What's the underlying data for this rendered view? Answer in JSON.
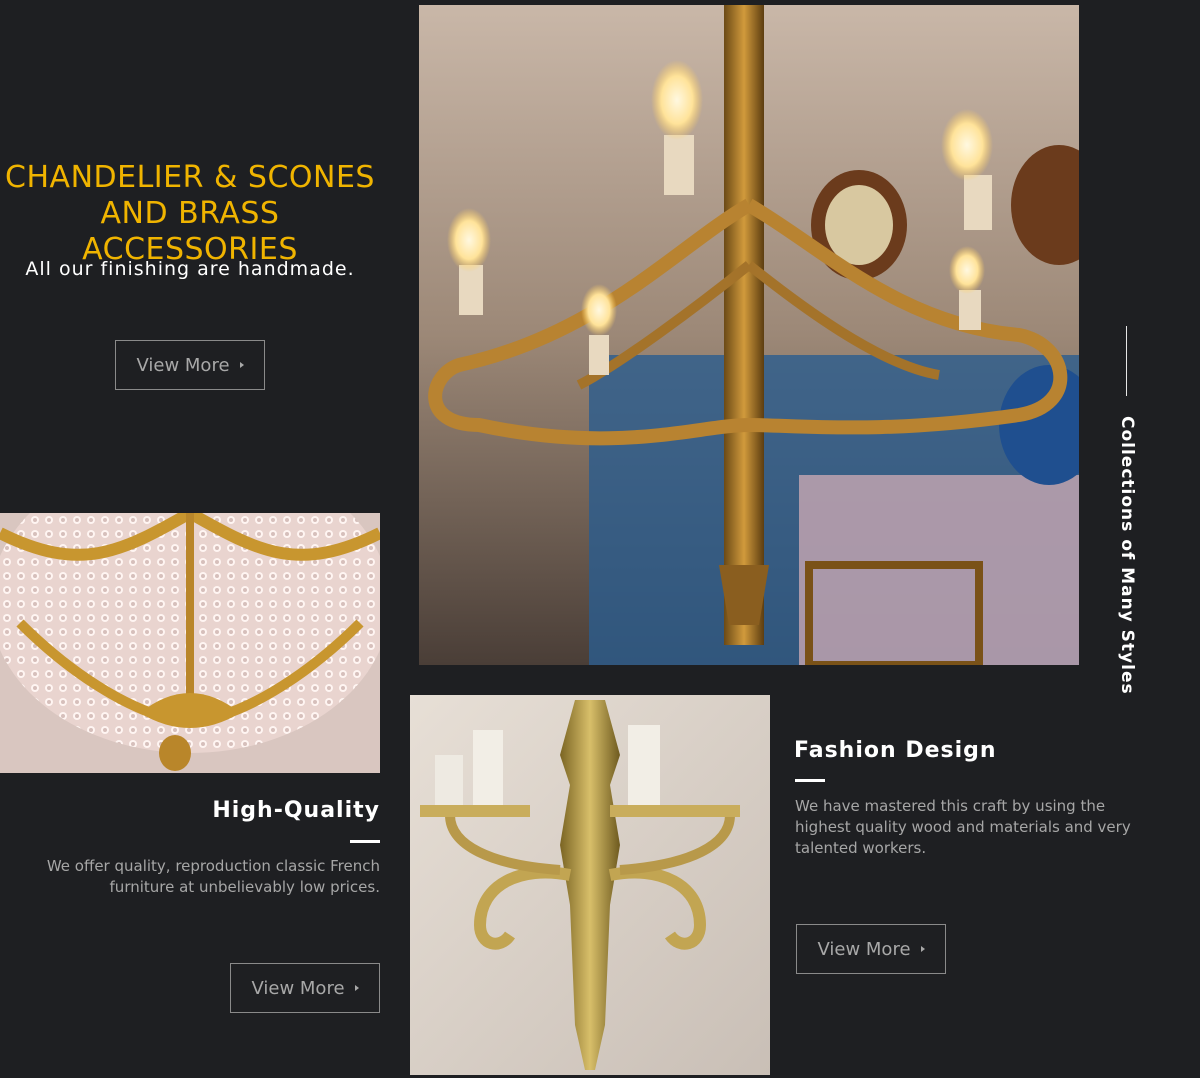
{
  "hero": {
    "title_line1": "CHANDELIER & SCONES",
    "title_line2": "AND BRASS ACCESSORIES",
    "subtitle": "All our finishing are handmade.",
    "button_label": "View More"
  },
  "images": {
    "main": "chandelier-photo",
    "left": "crystal-basket-chandelier-photo",
    "bottom": "brass-wall-sconce-photo"
  },
  "features": {
    "quality": {
      "title": "High-Quality",
      "text_line1": "We offer quality, reproduction classic French",
      "text_line2": "furniture at unbelievably low prices.",
      "button_label": "View More"
    },
    "fashion": {
      "title": "Fashion Design",
      "text_line1": "We have mastered this craft by using the",
      "text_line2": "highest quality wood and materials and very",
      "text_line3": "talented workers.",
      "button_label": "View More"
    }
  },
  "side_label": "Collections of Many Styles",
  "colors": {
    "background": "#1e1f22",
    "accent": "#f0b400",
    "button_border": "#8a8a8a"
  }
}
